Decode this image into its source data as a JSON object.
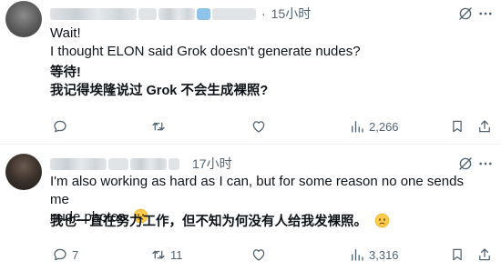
{
  "colors": {
    "text": "#0f1419",
    "muted": "#536471",
    "divider": "#eff3f4"
  },
  "tweets": [
    {
      "time": "15小时",
      "separator": "·",
      "text_en_lines": [
        "Wait!",
        "I thought ELON said Grok doesn't generate nudes?"
      ],
      "text_zh_lines": [
        "等待!",
        "我记得埃隆说过 Grok 不会生成裸照?"
      ],
      "has_emoji": false,
      "actions": {
        "reply": "",
        "retweet": "",
        "like": "",
        "views": "2,266"
      }
    },
    {
      "time": "17小时",
      "text_en_lines": [
        "I'm also working as hard as I can, but for some reason no one sends me",
        "nude photos."
      ],
      "text_zh_lines": [
        "我也一直在努力工作，但不知为何没有人给我发裸照。"
      ],
      "has_emoji": true,
      "emoji": "worried-face-icon",
      "actions": {
        "reply": "7",
        "retweet": "11",
        "like": "",
        "views": "3,316"
      }
    }
  ]
}
